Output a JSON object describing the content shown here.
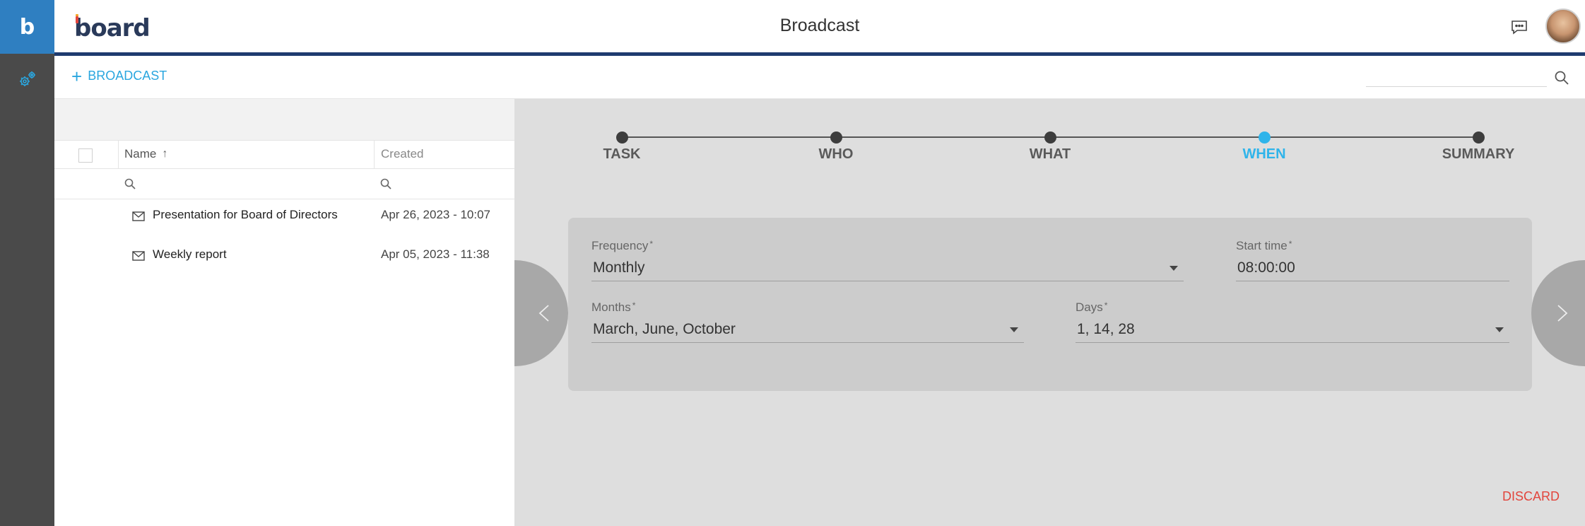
{
  "app": {
    "brand": "board",
    "logo_letter": "b",
    "title": "Broadcast"
  },
  "rail": {
    "items": [
      {
        "icon": "settings-gears-icon"
      }
    ]
  },
  "header": {
    "icons": [
      "chat-icon"
    ],
    "avatar": "user-avatar"
  },
  "toolbar": {
    "add_label": "BROADCAST",
    "search_placeholder": ""
  },
  "list": {
    "columns": {
      "name": "Name",
      "created": "Created"
    },
    "rows": [
      {
        "name": "Presentation for Board of Directors",
        "created": "Apr 26, 2023 - 10:07"
      },
      {
        "name": "Weekly report",
        "created": "Apr 05, 2023 - 11:38"
      }
    ]
  },
  "wizard": {
    "steps": [
      {
        "label": "TASK",
        "active": false
      },
      {
        "label": "WHO",
        "active": false
      },
      {
        "label": "WHAT",
        "active": false
      },
      {
        "label": "WHEN",
        "active": true
      },
      {
        "label": "SUMMARY",
        "active": false
      }
    ],
    "fields": {
      "frequency": {
        "label": "Frequency",
        "required": "*",
        "value": "Monthly"
      },
      "start_time": {
        "label": "Start time",
        "required": "*",
        "value": "08:00:00"
      },
      "months": {
        "label": "Months",
        "required": "*",
        "value": "March, June, October"
      },
      "days": {
        "label": "Days",
        "required": "*",
        "value": "1, 14, 28"
      }
    },
    "discard_label": "DISCARD"
  },
  "colors": {
    "accent": "#2fb4ea",
    "brand_blue": "#2f7fc1",
    "navy_stripe": "#1f3b6f",
    "discard_red": "#e2453c"
  }
}
